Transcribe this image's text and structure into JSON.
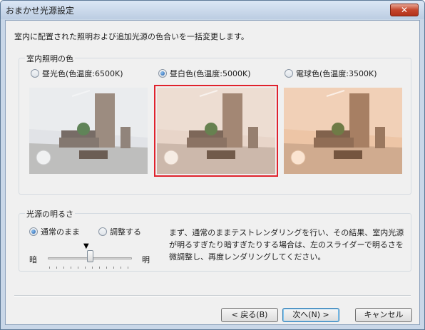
{
  "window": {
    "title": "おまかせ光源設定",
    "close_glyph": "✕"
  },
  "intro": "室内に配置された照明および追加光源の色合いを一括変更します。",
  "room_color_group": {
    "legend": "室内照明の色",
    "options": [
      {
        "label": "昼光色(色温度:6500K)",
        "selected": false,
        "tint": "#cfd3d8"
      },
      {
        "label": "昼白色(色温度:5000K)",
        "selected": true,
        "tint": "#e4cbbd"
      },
      {
        "label": "電球色(色温度:3500K)",
        "selected": false,
        "tint": "#efbf9b"
      }
    ]
  },
  "brightness_group": {
    "legend": "光源の明るさ",
    "options": [
      {
        "label": "通常のまま",
        "selected": true
      },
      {
        "label": "調整する",
        "selected": false
      }
    ],
    "slider": {
      "min_label": "暗",
      "max_label": "明",
      "marker": "▼",
      "value": 0.5
    },
    "description": "まず、通常のままテストレンダリングを行い、その結果、室内光源が明るすぎたり暗すぎたりする場合は、左のスライダーで明るさを微調整し、再度レンダリングしてください。"
  },
  "buttons": {
    "back": "< 戻る(B)",
    "next": "次へ(N) >",
    "cancel": "キャンセル"
  },
  "colors": {
    "selection": "#e0222c",
    "accent": "#1c5aa8"
  }
}
